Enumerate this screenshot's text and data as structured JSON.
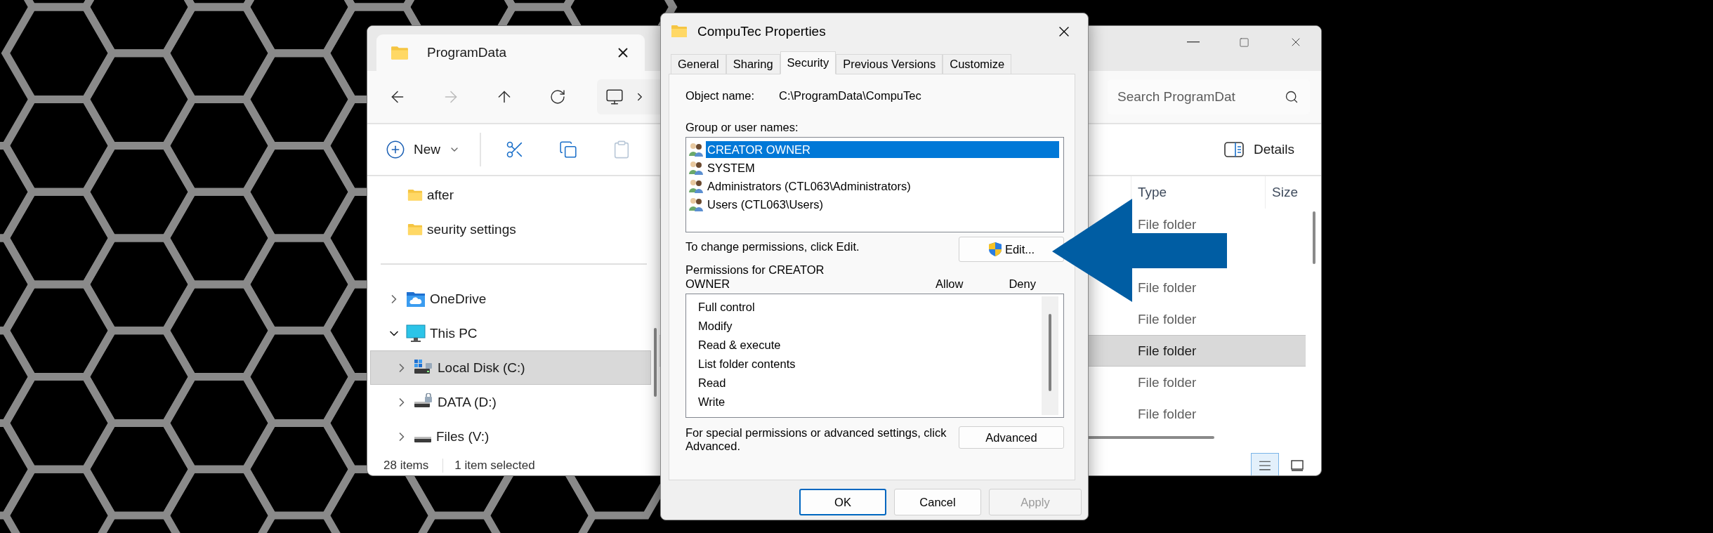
{
  "explorer": {
    "tab_title": "ProgramData",
    "search": {
      "placeholder": "Search ProgramDat"
    },
    "new_button": "New",
    "details_button": "Details",
    "nav_folders": [
      {
        "label": "after",
        "selected": false
      },
      {
        "label": "seurity settings",
        "selected": false
      }
    ],
    "nav_tree": [
      {
        "label": "OneDrive",
        "kind": "cloud",
        "expanded": false,
        "selected": false
      },
      {
        "label": "This PC",
        "kind": "pc",
        "expanded": true,
        "selected": false,
        "children": [
          {
            "label": "Local Disk (C:)",
            "kind": "system-drive",
            "expanded": false,
            "selected": true
          },
          {
            "label": "DATA (D:)",
            "kind": "locked-drive",
            "expanded": false,
            "selected": false
          },
          {
            "label": "Files (V:)",
            "kind": "drive",
            "expanded": false,
            "selected": false
          }
        ]
      }
    ],
    "columns": [
      "Type",
      "Size"
    ],
    "rows": [
      {
        "type": "File folder",
        "selected": false
      },
      {
        "selected": false
      },
      {
        "type": "File folder",
        "selected": false
      },
      {
        "type": "File folder",
        "selected": false
      },
      {
        "type": "File folder",
        "selected": true
      },
      {
        "type": "File folder",
        "selected": false
      },
      {
        "type": "File folder",
        "selected": false
      }
    ],
    "status": {
      "item_count": "28 items",
      "selection": "1 item selected"
    },
    "view_buttons": [
      {
        "kind": "details",
        "selected": true
      },
      {
        "kind": "preview",
        "selected": false
      }
    ]
  },
  "dialog": {
    "title": "CompuTec Properties",
    "tabs": [
      {
        "label": "General",
        "selected": false
      },
      {
        "label": "Sharing",
        "selected": false
      },
      {
        "label": "Security",
        "selected": true
      },
      {
        "label": "Previous Versions",
        "selected": false
      },
      {
        "label": "Customize",
        "selected": false
      }
    ],
    "object_name_label": "Object name:",
    "object_name": "C:\\ProgramData\\CompuTec",
    "group_label": "Group or user names:",
    "principals": [
      {
        "name": "CREATOR OWNER",
        "selected": true
      },
      {
        "name": "SYSTEM",
        "selected": false
      },
      {
        "name": "Administrators (CTL063\\Administrators)",
        "selected": false
      },
      {
        "name": "Users (CTL063\\Users)",
        "selected": false
      }
    ],
    "change_hint": "To change permissions, click Edit.",
    "edit_button": "Edit...",
    "permissions_label": "Permissions for CREATOR OWNER",
    "allow_header": "Allow",
    "deny_header": "Deny",
    "permissions": [
      "Full control",
      "Modify",
      "Read & execute",
      "List folder contents",
      "Read",
      "Write"
    ],
    "advanced_hint": "For special permissions or advanced settings, click Advanced.",
    "advanced_button": "Advanced",
    "buttons": [
      {
        "label": "OK",
        "kind": "default",
        "disabled": false
      },
      {
        "label": "Cancel",
        "kind": "normal",
        "disabled": false
      },
      {
        "label": "Apply",
        "kind": "normal",
        "disabled": true
      }
    ]
  }
}
